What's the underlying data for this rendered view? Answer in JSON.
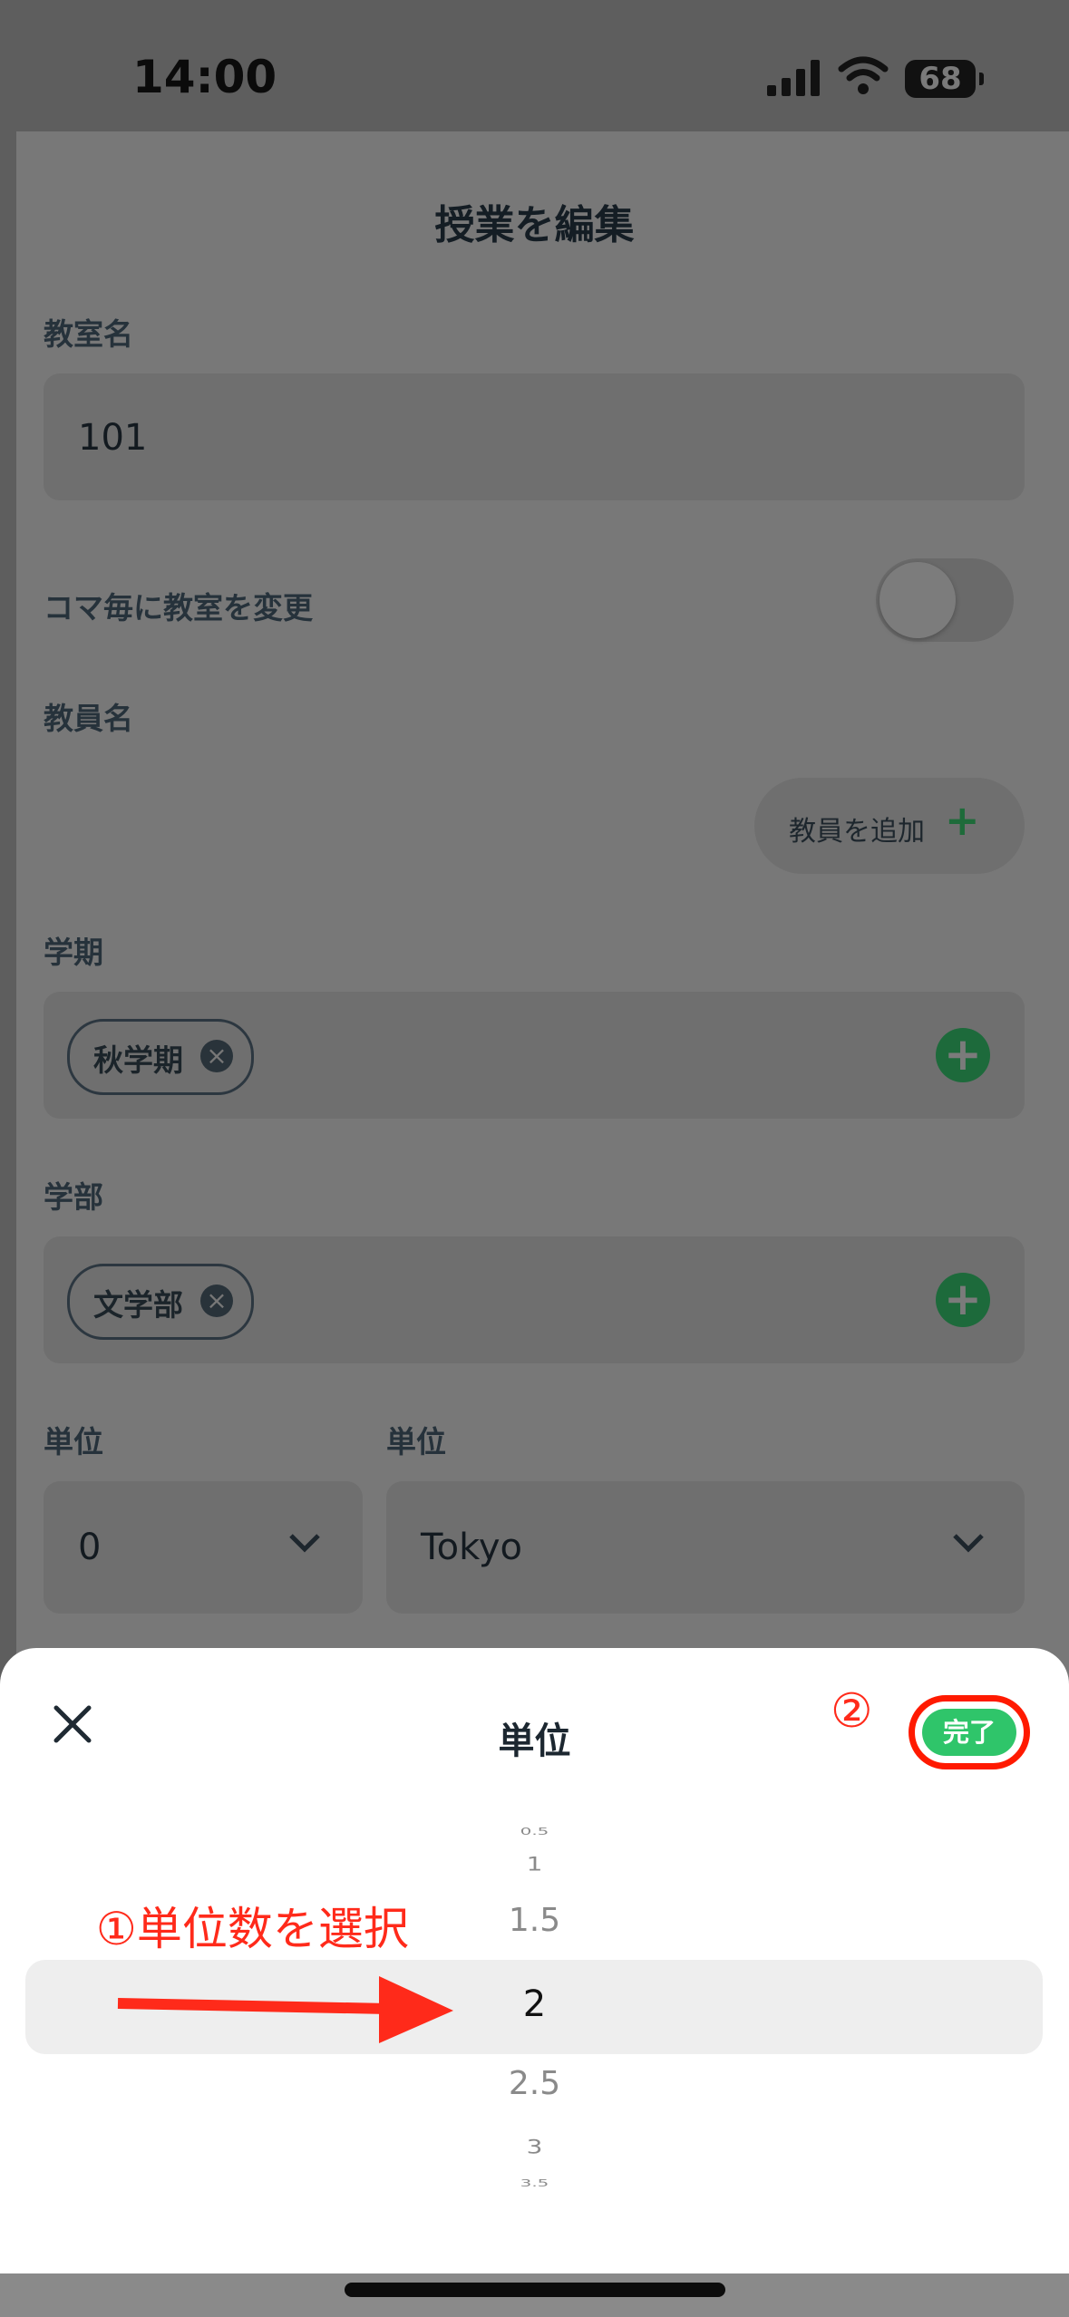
{
  "status": {
    "time": "14:00",
    "battery": "68",
    "icons": [
      "cellular-signal-icon",
      "wifi-icon",
      "battery-icon"
    ]
  },
  "page": {
    "title": "授業を編集",
    "classroom": {
      "label": "教室名",
      "value": "101"
    },
    "per_period_toggle": {
      "label": "コマ毎に教室を変更",
      "on": false
    },
    "teachers": {
      "label": "教員名",
      "add_label": "教員を追加"
    },
    "term": {
      "label": "学期",
      "chip": "秋学期"
    },
    "faculty": {
      "label": "学部",
      "chip": "文学部"
    },
    "credits": {
      "label": "単位",
      "value": "0"
    },
    "region": {
      "label": "単位",
      "value": "Tokyo"
    }
  },
  "sheet": {
    "title": "単位",
    "done_label": "完了",
    "picker": [
      "0.5",
      "1",
      "1.5",
      "2",
      "2.5",
      "3",
      "3.5"
    ],
    "selected_value": "2",
    "annotation_select": "①単位数を選択",
    "annotation_done": "②",
    "accent_color": "#2fc56a",
    "annotation_color": "#ff2a1a"
  }
}
